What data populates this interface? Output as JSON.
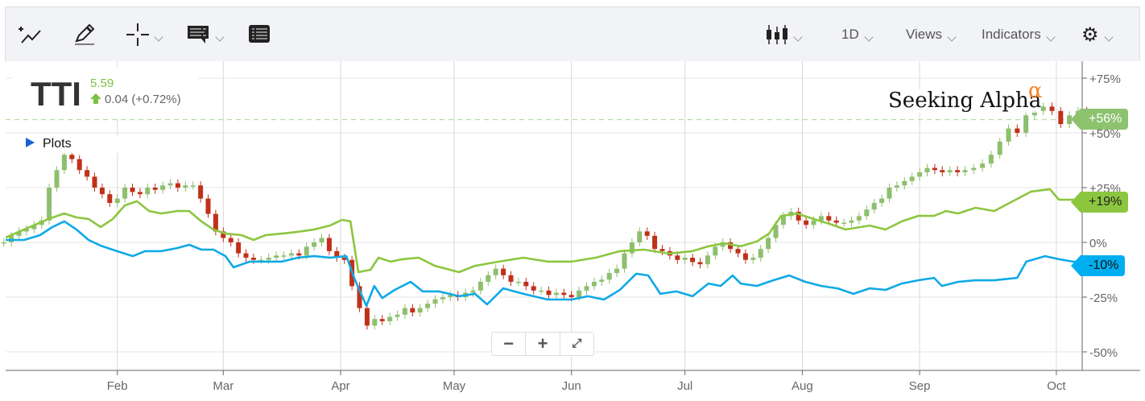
{
  "toolbar": {
    "timeframe": "1D",
    "views": "Views",
    "indicators": "Indicators"
  },
  "quote": {
    "symbol": "TTI",
    "price": "5.59",
    "change": "0.04 (+0.72%)"
  },
  "plots_label": "Plots",
  "watermark": {
    "text": "Seeking Alpha",
    "alpha": "α"
  },
  "zoom_controls": {
    "minus": "−",
    "plus": "+",
    "fullscreen": "⤢"
  },
  "colors": {
    "green_line": "#8cc63f",
    "blue_line": "#0fa9e6",
    "candle_up": "#8dbf6e",
    "candle_down": "#c0311a",
    "grid": "#e6e6e6"
  },
  "chart_data": {
    "type": "line",
    "x_unit": "day of year",
    "y_unit": "percent change",
    "ylim": [
      -55,
      82
    ],
    "y_ticks": [
      {
        "value": 75,
        "label": "+75%"
      },
      {
        "value": 50,
        "label": "+50%"
      },
      {
        "value": 25,
        "label": "+25%"
      },
      {
        "value": 0,
        "label": "0%"
      },
      {
        "value": -25,
        "label": "-25%"
      },
      {
        "value": -50,
        "label": "-50%"
      }
    ],
    "x_ticks": [
      {
        "day": 31,
        "label": "Feb"
      },
      {
        "day": 59,
        "label": "Mar"
      },
      {
        "day": 90,
        "label": "Apr"
      },
      {
        "day": 120,
        "label": "May"
      },
      {
        "day": 151,
        "label": "Jun"
      },
      {
        "day": 181,
        "label": "Jul"
      },
      {
        "day": 212,
        "label": "Aug"
      },
      {
        "day": 243,
        "label": "Sep"
      },
      {
        "day": 276,
        "label": "Oct"
      }
    ],
    "last_value_tags": [
      {
        "series": "TTI",
        "label": "+56%",
        "value": 56,
        "color": "#8dc26f"
      },
      {
        "series": "green",
        "label": "+19%",
        "value": 19,
        "color": "#8cc63f"
      },
      {
        "series": "blue",
        "label": "-10%",
        "value": -10,
        "color": "#00aeef"
      }
    ],
    "series": [
      {
        "name": "green",
        "color": "#8cc63f",
        "points": [
          [
            1.5,
            2.2
          ],
          [
            6.4,
            5.9
          ],
          [
            12.8,
            10.7
          ],
          [
            17,
            13.2
          ],
          [
            20.2,
            11.4
          ],
          [
            23.4,
            10.7
          ],
          [
            26.6,
            7
          ],
          [
            29.8,
            10.7
          ],
          [
            33,
            16.9
          ],
          [
            36.2,
            18.8
          ],
          [
            39.4,
            14.3
          ],
          [
            42.6,
            13.2
          ],
          [
            46.8,
            14.3
          ],
          [
            50,
            14.3
          ],
          [
            53.2,
            9.6
          ],
          [
            56.4,
            5.9
          ],
          [
            59.6,
            4
          ],
          [
            63.8,
            3.3
          ],
          [
            67,
            1.1
          ],
          [
            70.2,
            3.3
          ],
          [
            74.5,
            4
          ],
          [
            78.7,
            4.8
          ],
          [
            83,
            5.9
          ],
          [
            87.2,
            7.7
          ],
          [
            90.4,
            10.3
          ],
          [
            92.6,
            9.6
          ],
          [
            94.7,
            -13.6
          ],
          [
            97.9,
            -12.5
          ],
          [
            100,
            -7
          ],
          [
            103.2,
            -8.8
          ],
          [
            106.4,
            -7.7
          ],
          [
            110.6,
            -7
          ],
          [
            114.9,
            -10.7
          ],
          [
            121.3,
            -13.6
          ],
          [
            125.5,
            -10.7
          ],
          [
            131.9,
            -8.8
          ],
          [
            138.3,
            -7
          ],
          [
            144.7,
            -8.8
          ],
          [
            151.1,
            -8.8
          ],
          [
            157.4,
            -7
          ],
          [
            163.8,
            -4
          ],
          [
            170.2,
            -3.3
          ],
          [
            176.6,
            -5.1
          ],
          [
            183,
            -4
          ],
          [
            187.2,
            -1.8
          ],
          [
            191.5,
            -0.4
          ],
          [
            195.7,
            -1.8
          ],
          [
            200,
            0.4
          ],
          [
            203.2,
            4
          ],
          [
            206.4,
            12.1
          ],
          [
            210.6,
            13.2
          ],
          [
            214.9,
            10.7
          ],
          [
            219.1,
            8.5
          ],
          [
            223.4,
            5.9
          ],
          [
            229.8,
            7.7
          ],
          [
            234,
            5.9
          ],
          [
            238.3,
            9.6
          ],
          [
            242.6,
            12.1
          ],
          [
            246.8,
            12.1
          ],
          [
            250,
            14.3
          ],
          [
            253.2,
            13.2
          ],
          [
            257.4,
            15.8
          ],
          [
            261.7,
            14.3
          ],
          [
            266,
            18.8
          ],
          [
            270.2,
            23.2
          ],
          [
            274.5,
            24.3
          ],
          [
            276.6,
            19.5
          ],
          [
            280.9,
            19.5
          ],
          [
            284,
            20.6
          ]
        ]
      },
      {
        "name": "blue",
        "color": "#0fa9e6",
        "points": [
          [
            1.5,
            1.1
          ],
          [
            6.4,
            1.1
          ],
          [
            10.6,
            3.3
          ],
          [
            13.8,
            7
          ],
          [
            17,
            9.6
          ],
          [
            20.2,
            5.9
          ],
          [
            23.4,
            1.1
          ],
          [
            26.6,
            -1.5
          ],
          [
            30.9,
            -4
          ],
          [
            35.1,
            -6.3
          ],
          [
            38.3,
            -4
          ],
          [
            42.6,
            -4
          ],
          [
            46.8,
            -2.6
          ],
          [
            50,
            -1.1
          ],
          [
            53.2,
            -3.3
          ],
          [
            56.4,
            -3.3
          ],
          [
            59.6,
            -6.3
          ],
          [
            61.7,
            -11.4
          ],
          [
            66,
            -8.8
          ],
          [
            70.2,
            -8.8
          ],
          [
            74.5,
            -8.8
          ],
          [
            78.7,
            -7
          ],
          [
            83,
            -6.3
          ],
          [
            87.2,
            -7
          ],
          [
            91.5,
            -6.3
          ],
          [
            93.6,
            -16.2
          ],
          [
            96.8,
            -29
          ],
          [
            98.9,
            -19.9
          ],
          [
            101,
            -25.4
          ],
          [
            104.3,
            -21.7
          ],
          [
            108.5,
            -18
          ],
          [
            111.7,
            -22.4
          ],
          [
            116,
            -22.4
          ],
          [
            121.3,
            -24.6
          ],
          [
            125.5,
            -23.5
          ],
          [
            128.7,
            -28.3
          ],
          [
            133,
            -21
          ],
          [
            138.3,
            -23.5
          ],
          [
            144.7,
            -26.1
          ],
          [
            151.1,
            -26.1
          ],
          [
            155.3,
            -24.6
          ],
          [
            159.6,
            -26.1
          ],
          [
            163.8,
            -21.7
          ],
          [
            168.1,
            -14.3
          ],
          [
            171.3,
            -15.1
          ],
          [
            174.5,
            -23.5
          ],
          [
            178.7,
            -22.4
          ],
          [
            183,
            -24.6
          ],
          [
            187.2,
            -18.8
          ],
          [
            190.4,
            -19.9
          ],
          [
            193.6,
            -15.1
          ],
          [
            195.7,
            -18.8
          ],
          [
            200,
            -19.9
          ],
          [
            204.3,
            -17.3
          ],
          [
            208.5,
            -15.1
          ],
          [
            212.8,
            -18
          ],
          [
            217,
            -19.9
          ],
          [
            221.3,
            -21
          ],
          [
            225.5,
            -23.5
          ],
          [
            229.8,
            -21
          ],
          [
            234,
            -21.7
          ],
          [
            238.3,
            -18.8
          ],
          [
            242.6,
            -17.3
          ],
          [
            246.8,
            -16.2
          ],
          [
            248.9,
            -19.9
          ],
          [
            253.2,
            -18
          ],
          [
            257.4,
            -17.3
          ],
          [
            261.7,
            -17.3
          ],
          [
            267,
            -16.2
          ],
          [
            269.1,
            -8.8
          ],
          [
            273.4,
            -6.3
          ],
          [
            276.6,
            -7.7
          ],
          [
            279.8,
            -8.8
          ],
          [
            285.5,
            -8.8
          ]
        ]
      }
    ],
    "candles_close": [
      [
        1,
        0
      ],
      [
        3,
        3
      ],
      [
        5,
        5
      ],
      [
        7,
        6
      ],
      [
        9,
        8
      ],
      [
        11,
        10
      ],
      [
        13,
        25
      ],
      [
        15,
        33
      ],
      [
        17,
        40
      ],
      [
        19,
        38
      ],
      [
        21,
        33
      ],
      [
        23,
        30
      ],
      [
        25,
        25
      ],
      [
        27,
        22
      ],
      [
        29,
        18
      ],
      [
        31,
        20
      ],
      [
        33,
        25
      ],
      [
        35,
        23
      ],
      [
        37,
        22
      ],
      [
        39,
        25
      ],
      [
        41,
        24
      ],
      [
        43,
        26
      ],
      [
        45,
        27
      ],
      [
        47,
        25
      ],
      [
        49,
        26
      ],
      [
        51,
        26
      ],
      [
        53,
        20
      ],
      [
        55,
        13
      ],
      [
        57,
        5
      ],
      [
        59,
        2
      ],
      [
        61,
        0
      ],
      [
        63,
        -5
      ],
      [
        65,
        -7
      ],
      [
        67,
        -8
      ],
      [
        69,
        -8
      ],
      [
        71,
        -7
      ],
      [
        73,
        -6
      ],
      [
        75,
        -6
      ],
      [
        77,
        -5
      ],
      [
        79,
        -6
      ],
      [
        81,
        -2
      ],
      [
        83,
        0
      ],
      [
        85,
        2
      ],
      [
        87,
        -4
      ],
      [
        89,
        -7
      ],
      [
        91,
        -8
      ],
      [
        93,
        -20
      ],
      [
        95,
        -30
      ],
      [
        97,
        -38
      ],
      [
        99,
        -35
      ],
      [
        101,
        -36
      ],
      [
        103,
        -34
      ],
      [
        105,
        -33
      ],
      [
        107,
        -30
      ],
      [
        109,
        -32
      ],
      [
        111,
        -30
      ],
      [
        113,
        -28
      ],
      [
        115,
        -26
      ],
      [
        117,
        -25
      ],
      [
        119,
        -24
      ],
      [
        121,
        -25
      ],
      [
        123,
        -23
      ],
      [
        125,
        -22
      ],
      [
        127,
        -18
      ],
      [
        129,
        -15
      ],
      [
        131,
        -12
      ],
      [
        133,
        -15
      ],
      [
        135,
        -18
      ],
      [
        137,
        -18
      ],
      [
        139,
        -20
      ],
      [
        141,
        -22
      ],
      [
        143,
        -22
      ],
      [
        145,
        -24
      ],
      [
        147,
        -23
      ],
      [
        149,
        -24
      ],
      [
        151,
        -25
      ],
      [
        153,
        -22
      ],
      [
        155,
        -20
      ],
      [
        157,
        -18
      ],
      [
        159,
        -17
      ],
      [
        161,
        -14
      ],
      [
        163,
        -12
      ],
      [
        165,
        -5
      ],
      [
        167,
        0
      ],
      [
        169,
        5
      ],
      [
        171,
        3
      ],
      [
        173,
        -3
      ],
      [
        175,
        -4
      ],
      [
        177,
        -6
      ],
      [
        179,
        -8
      ],
      [
        181,
        -7
      ],
      [
        183,
        -9
      ],
      [
        185,
        -10
      ],
      [
        187,
        -6
      ],
      [
        189,
        -2
      ],
      [
        191,
        0
      ],
      [
        193,
        -3
      ],
      [
        195,
        -5
      ],
      [
        197,
        -8
      ],
      [
        199,
        -7
      ],
      [
        201,
        -3
      ],
      [
        203,
        2
      ],
      [
        205,
        8
      ],
      [
        207,
        12
      ],
      [
        209,
        14
      ],
      [
        211,
        10
      ],
      [
        213,
        8
      ],
      [
        215,
        10
      ],
      [
        217,
        12
      ],
      [
        219,
        10
      ],
      [
        221,
        9
      ],
      [
        223,
        9
      ],
      [
        225,
        10
      ],
      [
        227,
        12
      ],
      [
        229,
        15
      ],
      [
        231,
        18
      ],
      [
        233,
        20
      ],
      [
        235,
        25
      ],
      [
        237,
        26
      ],
      [
        239,
        28
      ],
      [
        241,
        30
      ],
      [
        243,
        32
      ],
      [
        245,
        34
      ],
      [
        247,
        33
      ],
      [
        249,
        32
      ],
      [
        251,
        33
      ],
      [
        253,
        32
      ],
      [
        255,
        33
      ],
      [
        257,
        34
      ],
      [
        259,
        36
      ],
      [
        261,
        40
      ],
      [
        263,
        46
      ],
      [
        265,
        52
      ],
      [
        267,
        50
      ],
      [
        269,
        58
      ],
      [
        271,
        60
      ],
      [
        273,
        62
      ],
      [
        275,
        60
      ],
      [
        277,
        54
      ],
      [
        279,
        58
      ],
      [
        281,
        60
      ],
      [
        283,
        56
      ]
    ]
  }
}
